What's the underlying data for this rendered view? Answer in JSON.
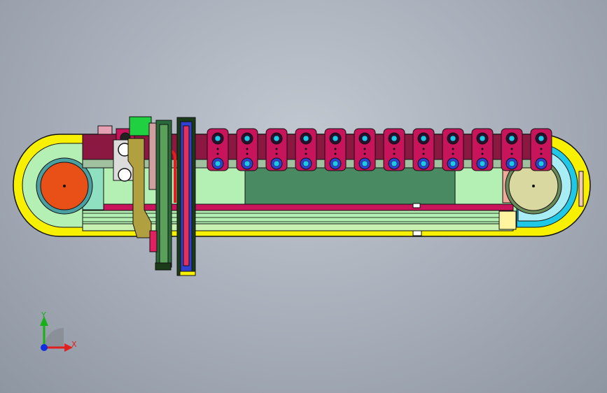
{
  "viewport": {
    "background_top": "#c2c8d0",
    "background_bottom": "#8e96a2"
  },
  "triad": {
    "x_label": "X",
    "y_label": "Y",
    "x_color": "#e02020",
    "y_color": "#18b018",
    "z_color": "#1030e0"
  },
  "model": {
    "colors": {
      "outline": "#111111",
      "yellow": "#f7f000",
      "light_green": "#b4f0b4",
      "mint": "#8fe0c0",
      "dark_green": "#2f6f4f",
      "magenta": "#c8145a",
      "pink": "#e6a0b4",
      "maroon": "#8a1840",
      "orange_pulley": "#e85018",
      "khaki_pulley": "#d8d8a0",
      "cyan": "#20c8e8",
      "blue": "#3040d0",
      "olive": "#b0a040",
      "green_box": "#20d040",
      "salmon": "#f0a898"
    },
    "fixture_count": 12
  }
}
